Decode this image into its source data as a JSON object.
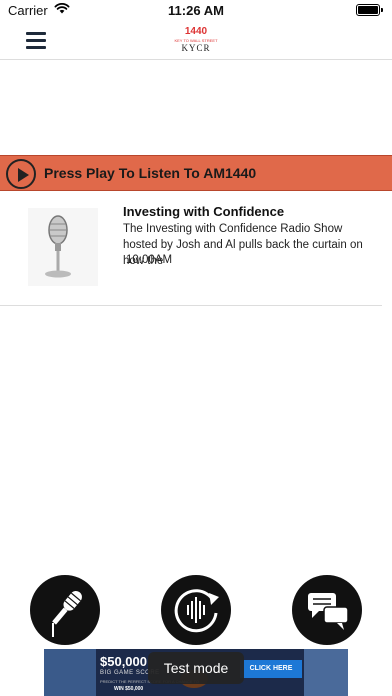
{
  "status_bar": {
    "carrier": "Carrier",
    "time": "11:26 AM"
  },
  "nav": {
    "logo": {
      "number": "1440",
      "subtitle": "KEY TO WALL STREET",
      "call_sign": "KYCR"
    }
  },
  "player": {
    "banner_label": "Press Play To Listen To AM1440",
    "banner_color": "#e0694a"
  },
  "shows": [
    {
      "title": "Investing with Confidence",
      "description": "The Investing with Confidence Radio Show hosted by Josh and Al pulls back the curtain on how the",
      "time": "10:00AM"
    }
  ],
  "actions": [
    {
      "icon": "microphone-icon"
    },
    {
      "icon": "live-stream-refresh-icon"
    },
    {
      "icon": "chat-bubbles-icon"
    }
  ],
  "ad": {
    "amount": "$50,000",
    "headline": "BIG GAME SCORE",
    "small_print": "PREDICT THE PERFECT SCORE FOR A CHANCE TO",
    "win": "WIN $50,000",
    "cta": "CLICK HERE"
  },
  "toast": {
    "text": "Test mode"
  }
}
